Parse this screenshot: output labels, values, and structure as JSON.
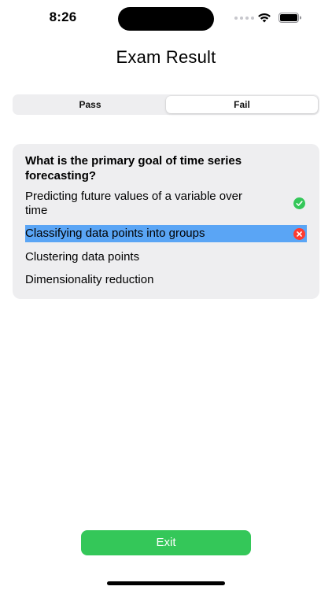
{
  "status_bar": {
    "time": "8:26",
    "icons": [
      "signal-icon",
      "wifi-icon",
      "battery-icon"
    ]
  },
  "header": {
    "title": "Exam Result"
  },
  "segments": {
    "items": [
      {
        "label": "Pass",
        "selected": false
      },
      {
        "label": "Fail",
        "selected": true
      }
    ]
  },
  "question": {
    "text": "What is the primary goal of time series forecasting?",
    "answers": [
      {
        "label": "Predicting future values of a variable over time",
        "status": "correct",
        "icon": "checkmark-circle-icon"
      },
      {
        "label": "Classifying data points into groups",
        "status": "selected-wrong",
        "icon": "x-circle-icon"
      },
      {
        "label": "Clustering data points",
        "status": "none"
      },
      {
        "label": "Dimensionality reduction",
        "status": "none"
      }
    ]
  },
  "footer": {
    "exit_label": "Exit"
  },
  "colors": {
    "correct": "#34c759",
    "wrong": "#ff3b30",
    "selected_highlight": "#5aa5f5",
    "card_background": "#eeeef0",
    "exit_button": "#34c759"
  }
}
